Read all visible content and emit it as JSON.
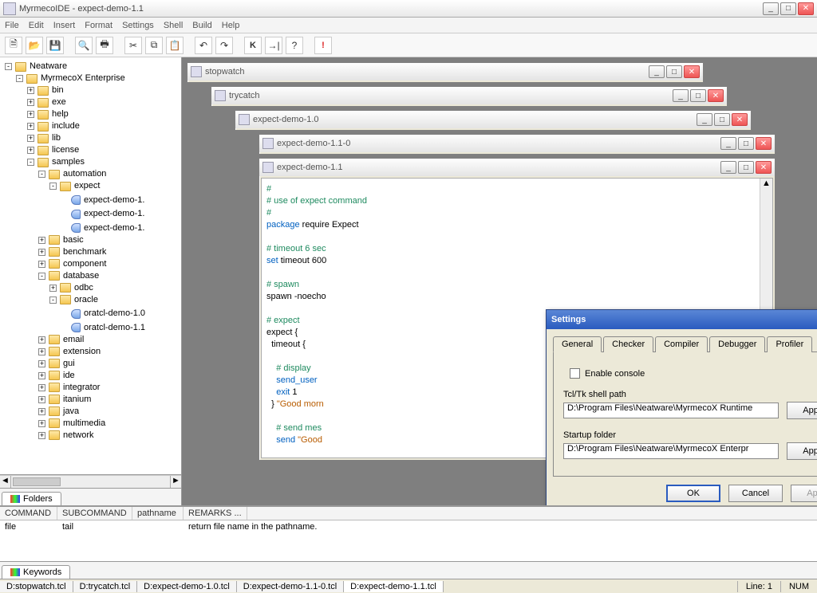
{
  "app": {
    "title": "MyrmecoIDE - expect-demo-1.1"
  },
  "menu": {
    "file": "File",
    "edit": "Edit",
    "insert": "Insert",
    "format": "Format",
    "settings": "Settings",
    "shell": "Shell",
    "build": "Build",
    "help": "Help"
  },
  "tree": {
    "root": "Neatware",
    "items": {
      "enterprise": "MyrmecoX Enterprise",
      "bin": "bin",
      "exe": "exe",
      "help": "help",
      "include": "include",
      "lib": "lib",
      "license": "license",
      "samples": "samples",
      "automation": "automation",
      "expect": "expect",
      "ed1": "expect-demo-1.",
      "ed2": "expect-demo-1.",
      "ed3": "expect-demo-1.",
      "basic": "basic",
      "benchmark": "benchmark",
      "component": "component",
      "database": "database",
      "odbc": "odbc",
      "oracle": "oracle",
      "od1": "oratcl-demo-1.0",
      "od2": "oratcl-demo-1.1",
      "email": "email",
      "extension": "extension",
      "gui": "gui",
      "ide": "ide",
      "integrator": "integrator",
      "itanium": "itanium",
      "java": "java",
      "multimedia": "multimedia",
      "network": "network"
    },
    "tab": "Folders"
  },
  "mdi": {
    "w1": "stopwatch",
    "w2": "trycatch",
    "w3": "expect-demo-1.0",
    "w4": "expect-demo-1.1-0",
    "w5": "expect-demo-1.1"
  },
  "code": {
    "l1": "#",
    "l2": "# use of expect command",
    "l3": "#",
    "l4a": "package",
    "l4b": " require Expect",
    "l5": "",
    "l6": "# timeout 6 sec",
    "l7a": "set",
    "l7b": " timeout 600",
    "l8": "",
    "l9": "# spawn",
    "l10": "spawn -noecho ",
    "l11": "",
    "l12": "# expect",
    "l13": "expect {",
    "l14": "  timeout {",
    "l15": "",
    "l16": "    # display",
    "l17a": "    send_user",
    "l17b": "",
    "l18a": "    exit",
    "l18b": " 1",
    "l19a": "  } ",
    "l19b": "\"Good morn",
    "l20": "",
    "l21": "    # send mes",
    "l22a": "    send ",
    "l22b": "\"Good"
  },
  "dialog": {
    "title": "Settings",
    "tabs": {
      "general": "General",
      "checker": "Checker",
      "compiler": "Compiler",
      "debugger": "Debugger",
      "profiler": "Profiler"
    },
    "enable_console": "Enable console",
    "path_label": "Tcl/Tk shell path",
    "path_value": "D:\\Program Files\\Neatware\\MyrmecoX Runtime",
    "startup_label": "Startup folder",
    "startup_value": "D:\\Program Files\\Neatware\\MyrmecoX Enterpr",
    "apply": "Apply",
    "ok": "OK",
    "cancel": "Cancel",
    "apply2": "Apply"
  },
  "keywords": {
    "h1": "COMMAND",
    "h2": "SUBCOMMAND",
    "h3": "pathname",
    "h4": "REMARKS ...",
    "r1": "file",
    "r2": "tail",
    "r3": "",
    "r4": "return file name in the pathname.",
    "tab": "Keywords"
  },
  "status": {
    "t1": "D:stopwatch.tcl",
    "t2": "D:trycatch.tcl",
    "t3": "D:expect-demo-1.0.tcl",
    "t4": "D:expect-demo-1.1-0.tcl",
    "t5": "D:expect-demo-1.1.tcl",
    "line": "Line: 1",
    "num": "NUM"
  }
}
